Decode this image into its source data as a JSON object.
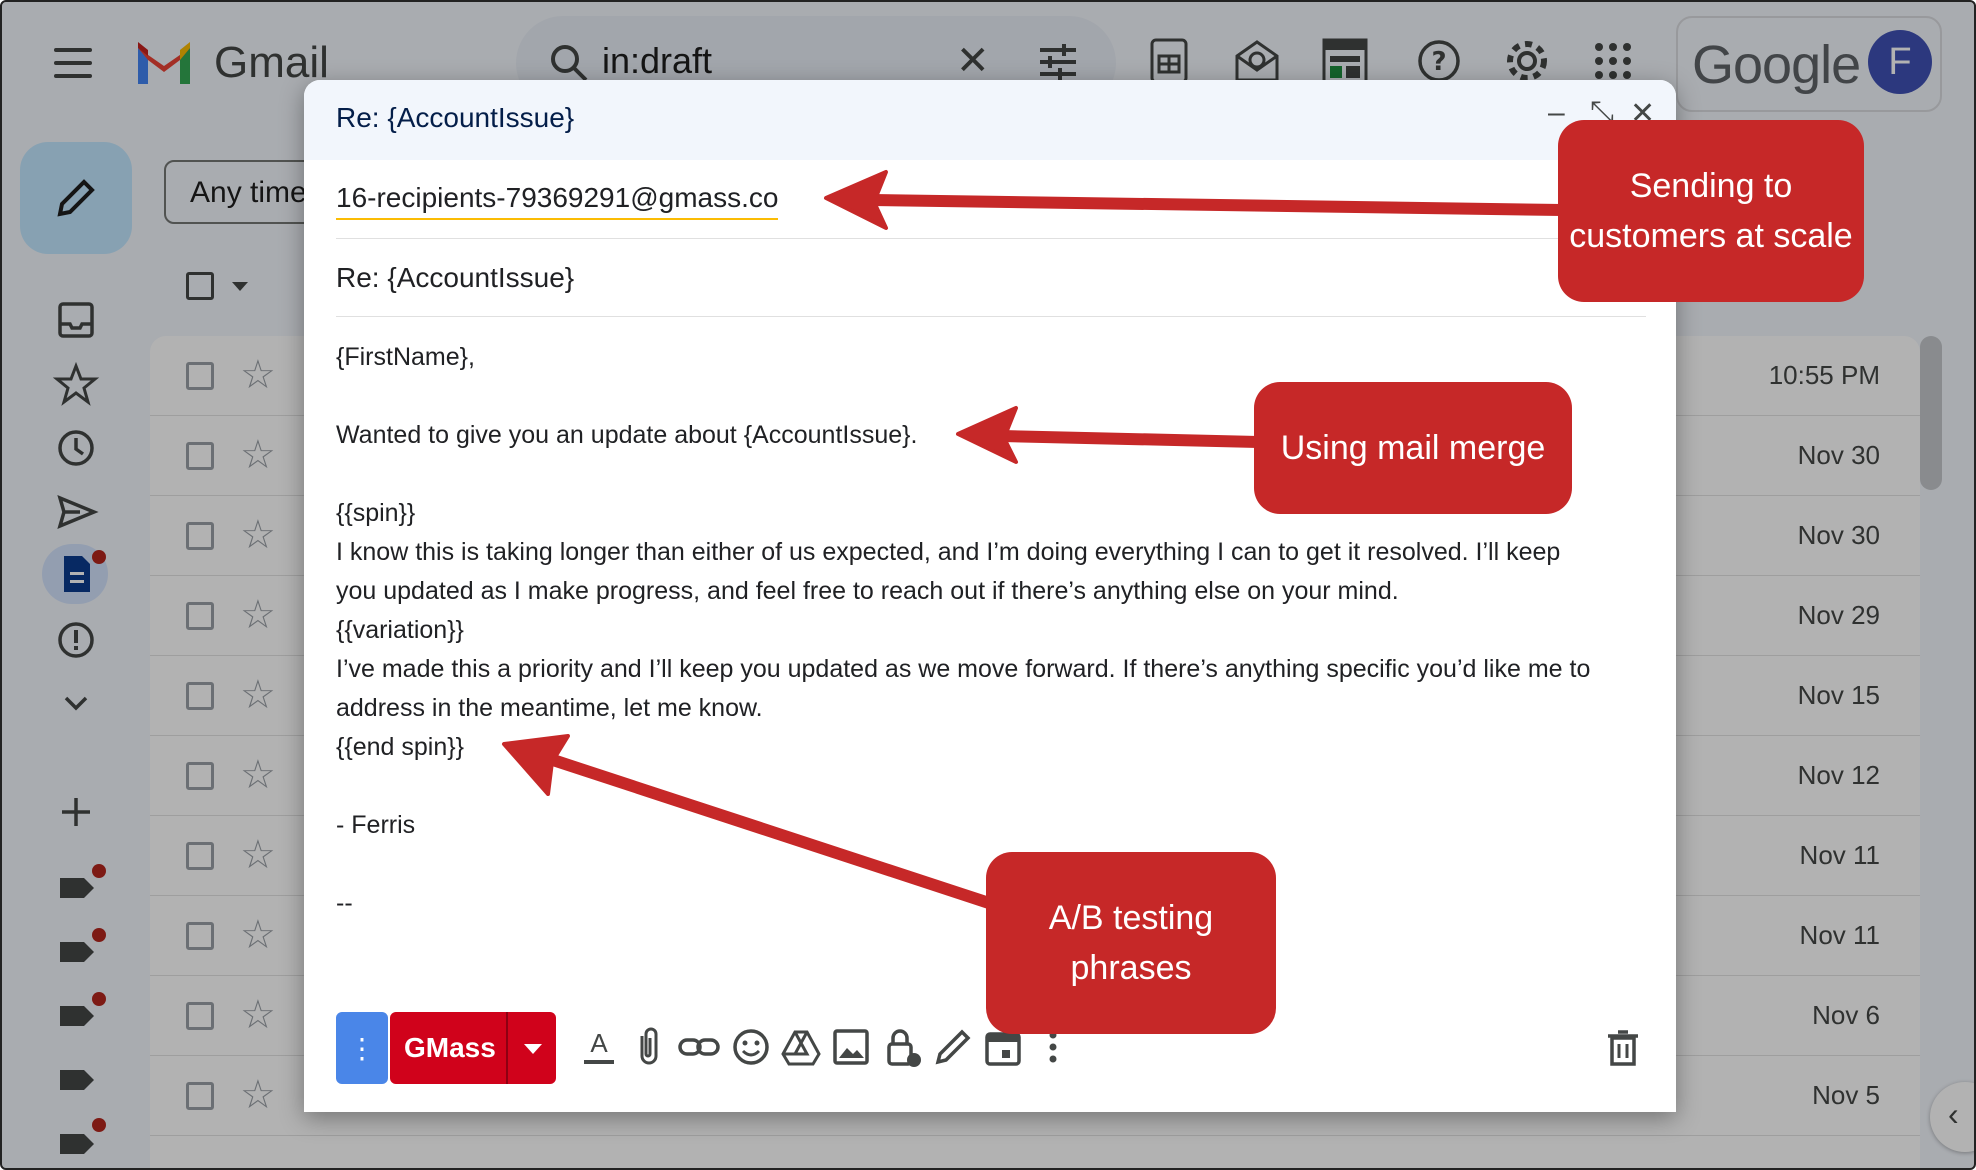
{
  "app": {
    "brand": "Gmail",
    "account_initial": "F",
    "google_wordmark": "Google"
  },
  "search": {
    "query": "in:draft"
  },
  "filter": {
    "label": "Any time"
  },
  "mail_list": {
    "dates": [
      "10:55 PM",
      "Nov 30",
      "Nov 30",
      "Nov 29",
      "Nov 15",
      "Nov 12",
      "Nov 11",
      "Nov 11",
      "Nov 6",
      "Nov 5"
    ]
  },
  "compose": {
    "window_title": "Re: {AccountIssue}",
    "to": "16-recipients-79369291@gmass.co",
    "subject": "Re: {AccountIssue}",
    "body_lines": [
      "{FirstName},",
      "",
      "Wanted to give you an update about {AccountIssue}.",
      "",
      "{{spin}}",
      "I know this is taking longer than either of us expected, and I’m doing everything I can to get it resolved. I’ll keep",
      "you updated as I make progress, and feel free to reach out if there’s anything else on your mind.",
      "{{variation}}",
      "I’ve made this a priority and I’ll keep you updated as we move forward. If there’s anything specific you’d like me to",
      "address in the meantime, let me know.",
      "{{end spin}}",
      "",
      "- Ferris",
      "",
      "--"
    ],
    "send_label": "GMass",
    "more_label": "⋮"
  },
  "annotations": {
    "recipients": "Sending to customers at scale",
    "merge": "Using mail merge",
    "ab_test": "A/B testing phrases",
    "color": "#c62828"
  }
}
